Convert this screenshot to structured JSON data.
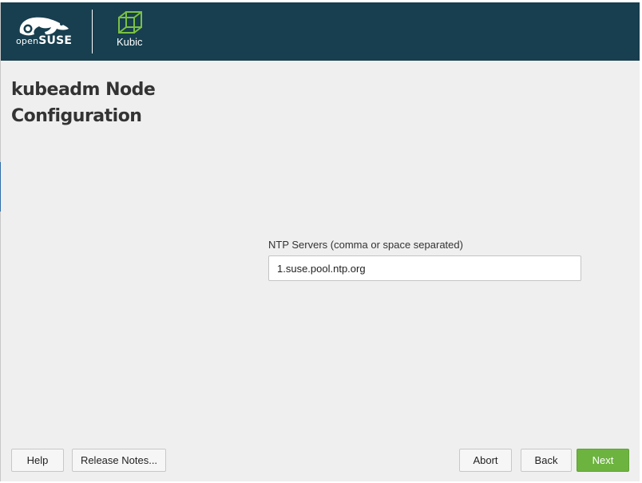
{
  "header": {
    "brand": {
      "prefix": "open",
      "name": "SUSE"
    },
    "product": "Kubic"
  },
  "page": {
    "title_line1": "kubeadm Node",
    "title_line2": "Configuration"
  },
  "ntp": {
    "label": "NTP Servers (comma or space separated)",
    "value": "1.suse.pool.ntp.org"
  },
  "buttons": {
    "help": "Help",
    "release_notes": "Release Notes...",
    "abort": "Abort",
    "back": "Back",
    "next": "Next"
  },
  "colors": {
    "header_bg": "#173f4f",
    "accent_green": "#6db33f"
  }
}
